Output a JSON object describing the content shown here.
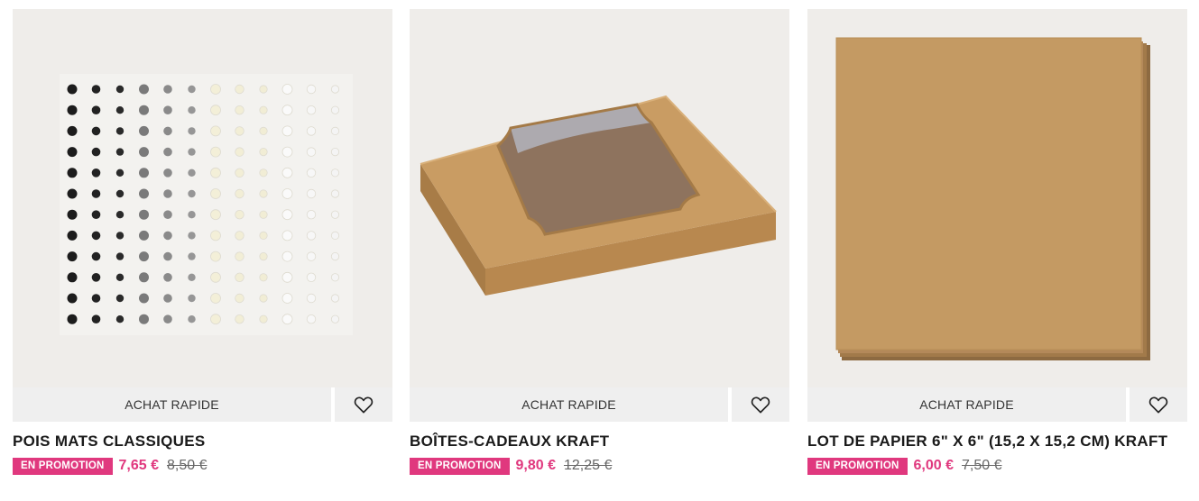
{
  "products": [
    {
      "title": "POIS MATS CLASSIQUES",
      "quick_label": "ACHAT RAPIDE",
      "promo_badge": "EN PROMOTION",
      "sale_price": "7,65 €",
      "old_price": "8,50 €",
      "image": "matte-dots-sheet",
      "wishlist_icon": "heart-icon"
    },
    {
      "title": "BOÎTES-CADEAUX KRAFT",
      "quick_label": "ACHAT RAPIDE",
      "promo_badge": "EN PROMOTION",
      "sale_price": "9,80 €",
      "old_price": "12,25 €",
      "image": "kraft-gift-box",
      "wishlist_icon": "heart-icon"
    },
    {
      "title": "LOT DE PAPIER 6\" X 6\" (15,2 X 15,2 CM) KRAFT",
      "quick_label": "ACHAT RAPIDE",
      "promo_badge": "EN PROMOTION",
      "sale_price": "6,00 €",
      "old_price": "7,50 €",
      "image": "kraft-paper-stack",
      "wishlist_icon": "heart-icon"
    }
  ],
  "colors": {
    "promo": "#e0387e",
    "image_bg": "#efedea",
    "button_bg": "#efefef",
    "kraft": "#c49a63"
  }
}
